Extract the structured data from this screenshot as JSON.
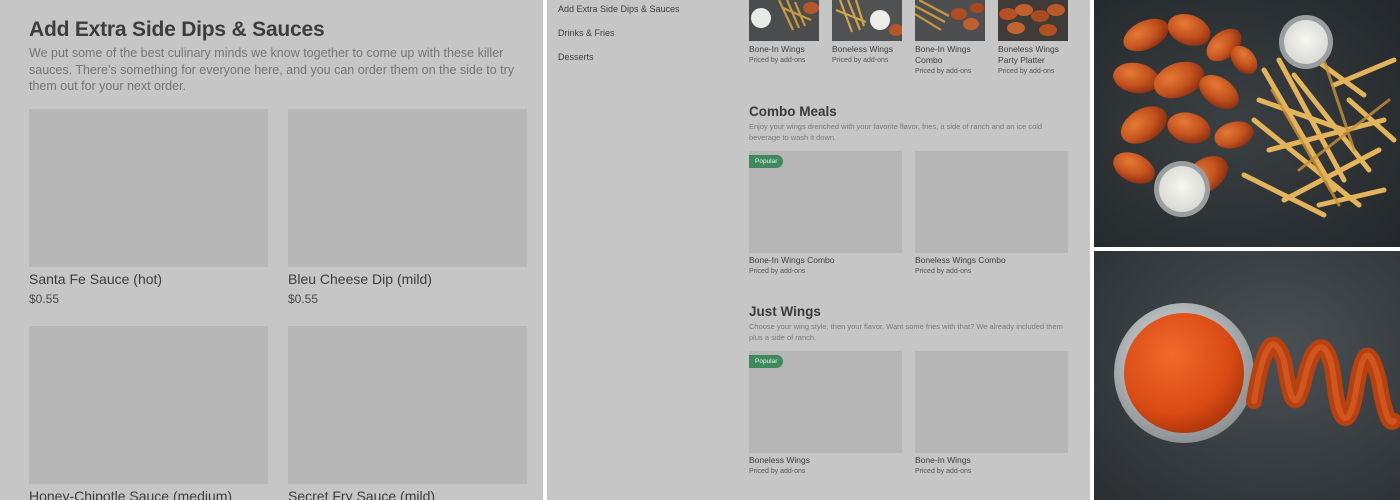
{
  "sauces_panel": {
    "title": "Add Extra Side Dips & Sauces",
    "description": "We put some of the best culinary minds we know together to come up with these killer sauces. There's something for everyone here, and you can order them on the side to try them out for your next order.",
    "items": [
      {
        "name": "Santa Fe Sauce (hot)",
        "price": "$0.55"
      },
      {
        "name": "Bleu Cheese Dip (mild)",
        "price": "$0.55"
      },
      {
        "name": "Honey-Chipotle Sauce (medium)",
        "price": ""
      },
      {
        "name": "Secret Fry Sauce (mild)",
        "price": ""
      }
    ]
  },
  "menu_panel": {
    "nav": [
      "Add Extra Side Dips & Sauces",
      "Drinks & Fries",
      "Desserts"
    ],
    "top_items": [
      {
        "name": "Bone-In Wings",
        "sub": "Priced by add-ons"
      },
      {
        "name": "Boneless Wings",
        "sub": "Priced by add-ons"
      },
      {
        "name": "Bone-In Wings Combo",
        "sub": "Priced by add-ons"
      },
      {
        "name": "Boneless Wings Party Platter",
        "sub": "Priced by add-ons"
      }
    ],
    "combo": {
      "title": "Combo Meals",
      "description": "Enjoy your wings drenched with your favorite flavor, fries, a side of ranch and an ice cold beverage to wash it down.",
      "items": [
        {
          "name": "Bone-In Wings Combo",
          "sub": "Priced by add-ons",
          "badge": "Popular"
        },
        {
          "name": "Boneless Wings Combo",
          "sub": "Priced by add-ons",
          "badge": ""
        }
      ]
    },
    "wings": {
      "title": "Just Wings",
      "description": "Choose your wing style, then your flavor. Want some fries with that? We already included them plus a side of ranch.",
      "items": [
        {
          "name": "Boneless Wings",
          "sub": "Priced by add-ons",
          "badge": "Popular"
        },
        {
          "name": "Bone-In Wings",
          "sub": "Priced by add-ons",
          "badge": ""
        }
      ]
    }
  },
  "photos": {
    "wings_photo": "wings-and-fries-photo",
    "sauce_photo": "sauce-bowl-photo"
  },
  "colors": {
    "panel_bg": "#c6c6c6",
    "placeholder": "#b7b7b7",
    "badge_green": "#3e8a5e",
    "slate": "#2f3437"
  }
}
